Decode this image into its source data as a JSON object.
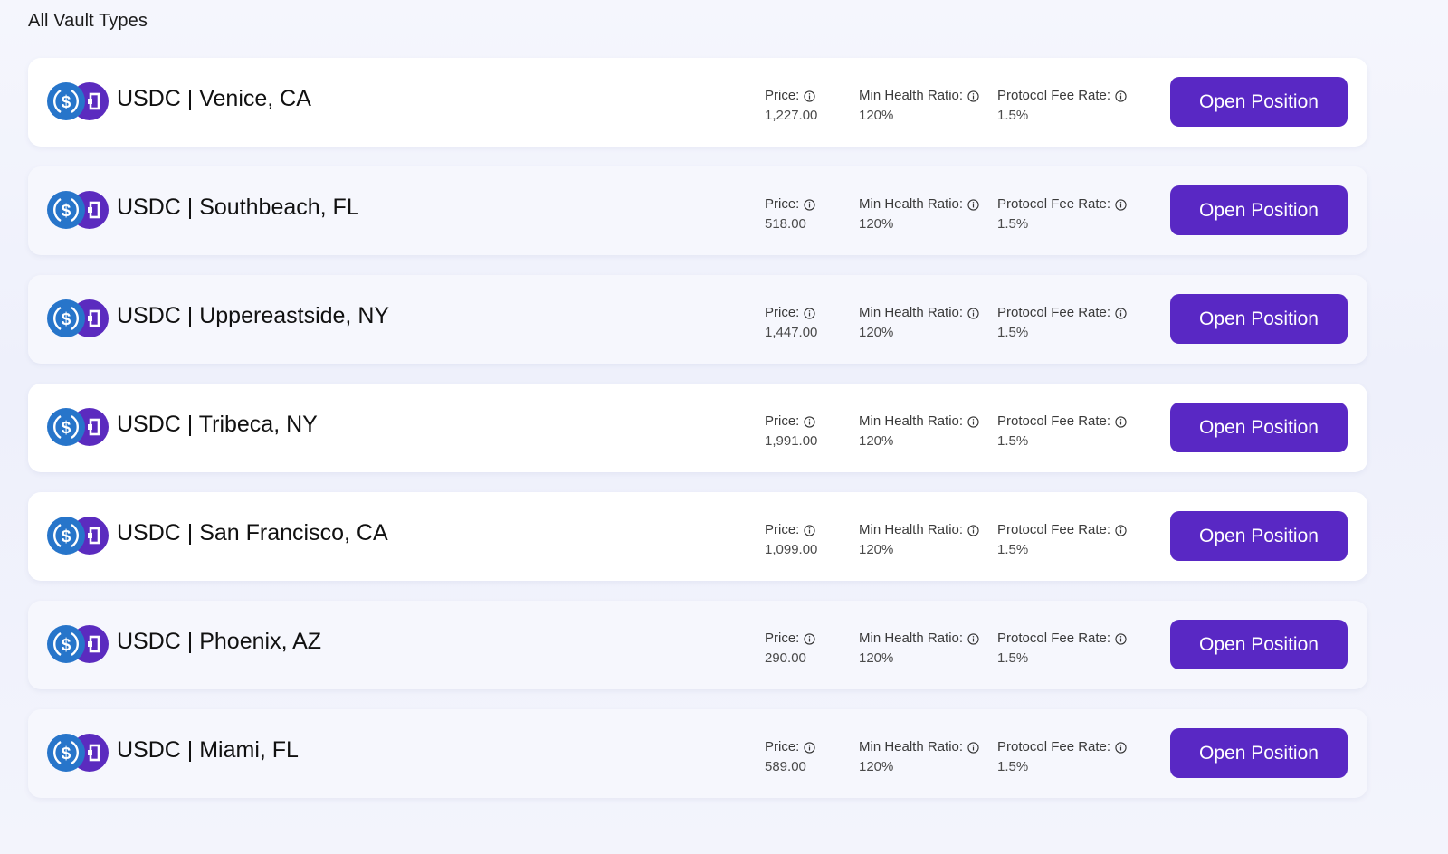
{
  "section": {
    "title": "All Vault Types"
  },
  "labels": {
    "price": "Price:",
    "min_health_ratio": "Min Health Ratio:",
    "protocol_fee_rate": "Protocol Fee Rate:",
    "open_position": "Open Position"
  },
  "icons": {
    "token_primary": "usdc-icon",
    "token_secondary": "protocol-token-icon",
    "info": "info-icon"
  },
  "colors": {
    "button": "#5928c4",
    "usdc": "#2775ca",
    "protocol_token": "#5b2bbf"
  },
  "vaults": [
    {
      "name": "USDC | Venice, CA",
      "price": "1,227.00",
      "min_health_ratio": "120%",
      "protocol_fee_rate": "1.5%"
    },
    {
      "name": "USDC | Southbeach, FL",
      "price": "518.00",
      "min_health_ratio": "120%",
      "protocol_fee_rate": "1.5%"
    },
    {
      "name": "USDC | Uppereastside, NY",
      "price": "1,447.00",
      "min_health_ratio": "120%",
      "protocol_fee_rate": "1.5%"
    },
    {
      "name": "USDC | Tribeca, NY",
      "price": "1,991.00",
      "min_health_ratio": "120%",
      "protocol_fee_rate": "1.5%"
    },
    {
      "name": "USDC | San Francisco, CA",
      "price": "1,099.00",
      "min_health_ratio": "120%",
      "protocol_fee_rate": "1.5%"
    },
    {
      "name": "USDC | Phoenix, AZ",
      "price": "290.00",
      "min_health_ratio": "120%",
      "protocol_fee_rate": "1.5%"
    },
    {
      "name": "USDC | Miami, FL",
      "price": "589.00",
      "min_health_ratio": "120%",
      "protocol_fee_rate": "1.5%"
    }
  ]
}
